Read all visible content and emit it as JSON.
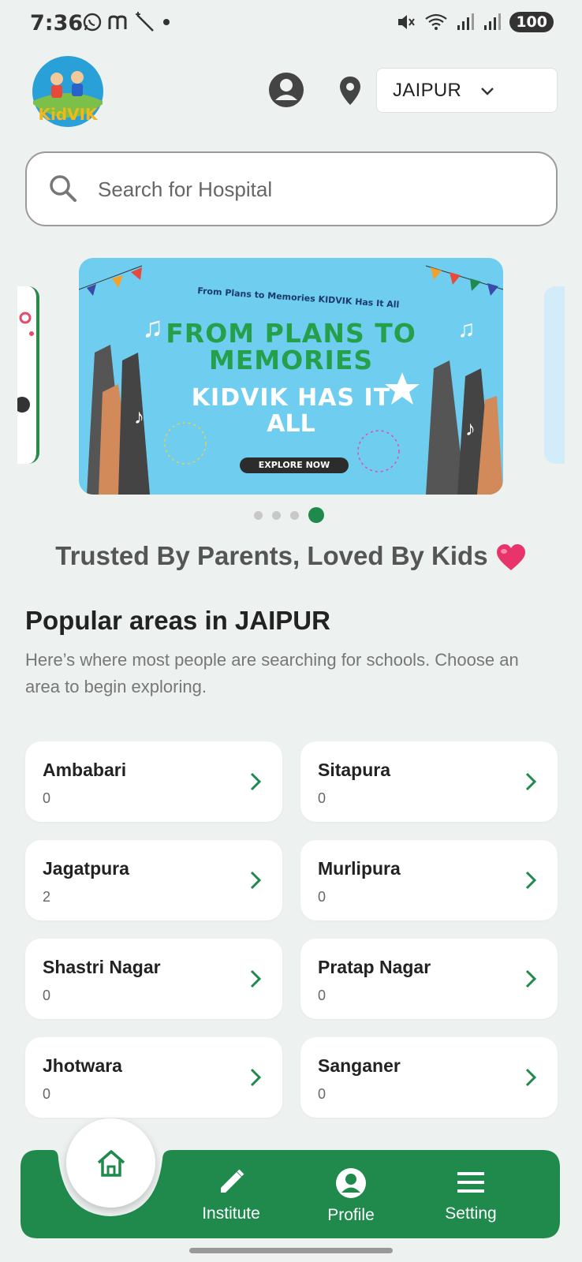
{
  "status_bar": {
    "time": "7:36",
    "battery": "100"
  },
  "header": {
    "logo_text": "KidVIK",
    "city": "JAIPUR"
  },
  "search": {
    "placeholder": "Search for Hospital"
  },
  "banner": {
    "tagline": "From Plans to Memories KIDVIK Has It All",
    "line1": "FROM PLANS TO",
    "line2": "MEMORIES",
    "line3": "KIDVIK HAS IT",
    "line4": "ALL",
    "cta": "EXPLORE NOW",
    "page_count": 4,
    "active_page": 4
  },
  "trusted_text": "Trusted By Parents, Loved By Kids",
  "popular": {
    "title": "Popular areas in JAIPUR",
    "description": "Here’s where most people are searching for schools. Choose an area to begin exploring.",
    "areas": [
      {
        "name": "Ambabari",
        "count": "0"
      },
      {
        "name": "Sitapura",
        "count": "0"
      },
      {
        "name": "Jagatpura",
        "count": "2"
      },
      {
        "name": "Murlipura",
        "count": "0"
      },
      {
        "name": "Shastri Nagar",
        "count": "0"
      },
      {
        "name": "Pratap Nagar",
        "count": "0"
      },
      {
        "name": "Jhotwara",
        "count": "0"
      },
      {
        "name": "Sanganer",
        "count": "0"
      }
    ]
  },
  "bottom_nav": {
    "items": [
      {
        "label": "Institute"
      },
      {
        "label": "Profile"
      },
      {
        "label": "Setting"
      }
    ]
  },
  "colors": {
    "primary_green": "#1f8a4c",
    "background": "#edf1f0"
  }
}
